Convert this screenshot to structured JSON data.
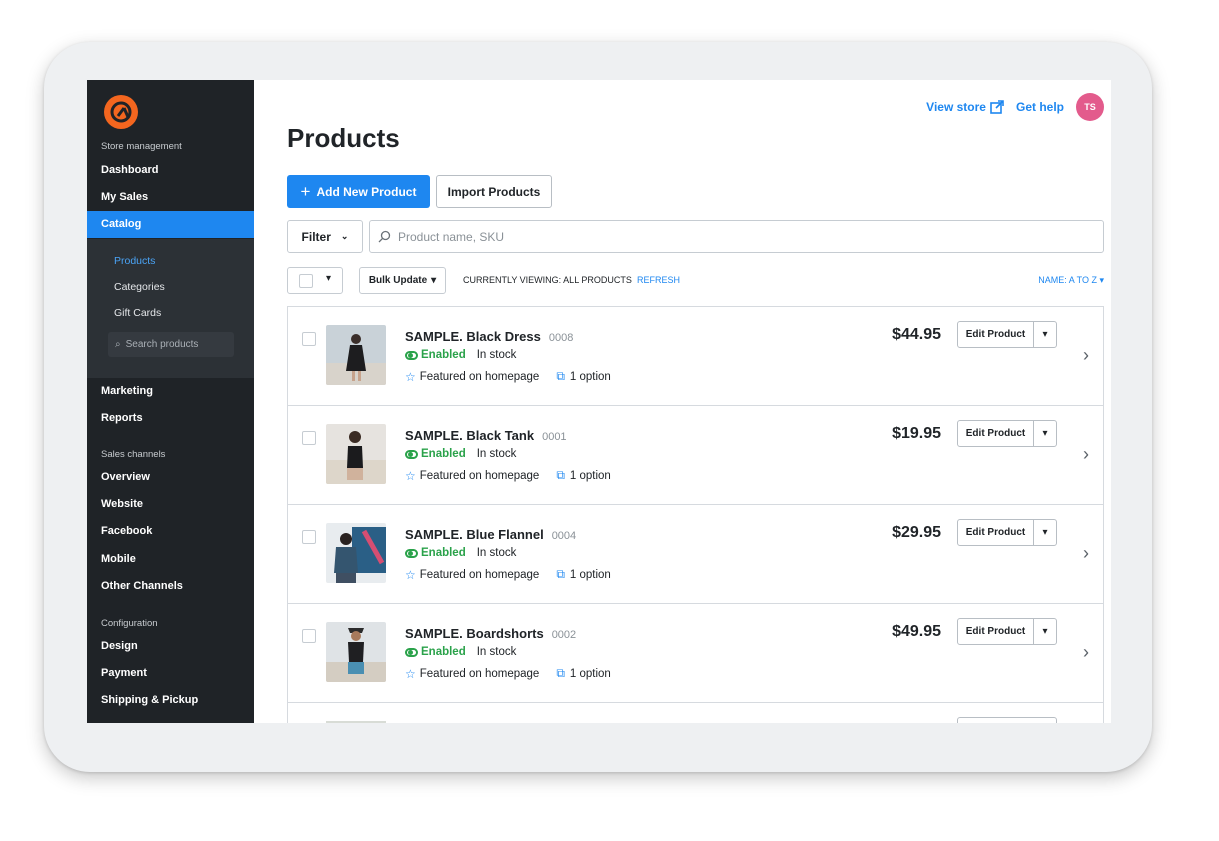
{
  "sidebar": {
    "section_store": "Store management",
    "items_top": [
      "Dashboard",
      "My Sales"
    ],
    "catalog": "Catalog",
    "submenu": [
      "Products",
      "Categories",
      "Gift Cards"
    ],
    "search_placeholder": "Search products",
    "items_mid": [
      "Marketing",
      "Reports"
    ],
    "section_sales": "Sales channels",
    "sales_items": [
      "Overview",
      "Website",
      "Facebook",
      "Mobile",
      "Other Channels"
    ],
    "section_config": "Configuration",
    "config_items": [
      "Design",
      "Payment",
      "Shipping & Pickup"
    ]
  },
  "header": {
    "view_store": "View store",
    "get_help": "Get help",
    "avatar_initials": "TS"
  },
  "page": {
    "title": "Products",
    "add_button": "Add New Product",
    "import_button": "Import Products",
    "filter": "Filter",
    "search_placeholder": "Product name, SKU",
    "bulk_update": "Bulk Update",
    "currently_viewing": "CURRENTLY VIEWING: ALL PRODUCTS",
    "refresh": "REFRESH",
    "sort": "NAME: A TO Z"
  },
  "products": [
    {
      "name": "SAMPLE. Black Dress",
      "sku": "0008",
      "status": "Enabled",
      "stock": "In stock",
      "featured": "Featured on homepage",
      "options": "1 option",
      "price": "$44.95",
      "edit": "Edit Product"
    },
    {
      "name": "SAMPLE. Black Tank",
      "sku": "0001",
      "status": "Enabled",
      "stock": "In stock",
      "featured": "Featured on homepage",
      "options": "1 option",
      "price": "$19.95",
      "edit": "Edit Product"
    },
    {
      "name": "SAMPLE. Blue Flannel",
      "sku": "0004",
      "status": "Enabled",
      "stock": "In stock",
      "featured": "Featured on homepage",
      "options": "1 option",
      "price": "$29.95",
      "edit": "Edit Product"
    },
    {
      "name": "SAMPLE. Boardshorts",
      "sku": "0002",
      "status": "Enabled",
      "stock": "In stock",
      "featured": "Featured on homepage",
      "options": "1 option",
      "price": "$49.95",
      "edit": "Edit Product"
    }
  ],
  "colors": {
    "accent": "#1e87f0",
    "sidebar_bg": "#1f2327",
    "enabled": "#2aa24a",
    "logo": "#f3661f",
    "avatar": "#e35b8c"
  }
}
